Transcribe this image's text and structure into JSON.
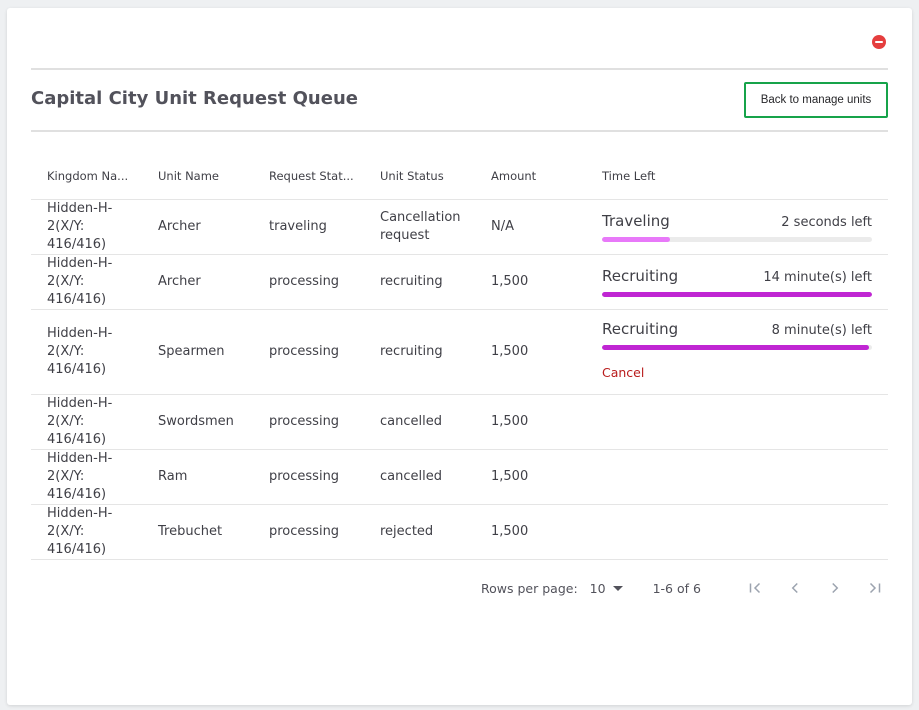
{
  "header": {
    "title": "Capital City Unit Request Queue",
    "back_button_label": "Back to manage units",
    "close_icon": "minus-circle-icon",
    "close_color": "#e53e3e",
    "back_button_border_color": "#16a34a"
  },
  "table": {
    "columns": [
      "Kingdom Na...",
      "Unit Name",
      "Request Stat...",
      "Unit Status",
      "Amount",
      "Time Left"
    ],
    "rows": [
      {
        "kingdom": "Hidden-H-2(X/Y: 416/416)",
        "unit_name": "Archer",
        "request_status": "traveling",
        "unit_status": "Cancellation request",
        "amount": "N/A",
        "time_status": "Traveling",
        "time_remaining": "2 seconds left",
        "progress": 0.25,
        "has_cancel": false
      },
      {
        "kingdom": "Hidden-H-2(X/Y: 416/416)",
        "unit_name": "Archer",
        "request_status": "processing",
        "unit_status": "recruiting",
        "amount": "1,500",
        "time_status": "Recruiting",
        "time_remaining": "14 minute(s) left",
        "progress": 1.0,
        "has_cancel": false
      },
      {
        "kingdom": "Hidden-H-2(X/Y: 416/416)",
        "unit_name": "Spearmen",
        "request_status": "processing",
        "unit_status": "recruiting",
        "amount": "1,500",
        "time_status": "Recruiting",
        "time_remaining": "8 minute(s) left",
        "progress": 0.99,
        "has_cancel": true,
        "cancel_label": "Cancel"
      },
      {
        "kingdom": "Hidden-H-2(X/Y: 416/416)",
        "unit_name": "Swordsmen",
        "request_status": "processing",
        "unit_status": "cancelled",
        "amount": "1,500",
        "time_status": "",
        "time_remaining": "",
        "progress": null,
        "has_cancel": false
      },
      {
        "kingdom": "Hidden-H-2(X/Y: 416/416)",
        "unit_name": "Ram",
        "request_status": "processing",
        "unit_status": "cancelled",
        "amount": "1,500",
        "time_status": "",
        "time_remaining": "",
        "progress": null,
        "has_cancel": false
      },
      {
        "kingdom": "Hidden-H-2(X/Y: 416/416)",
        "unit_name": "Trebuchet",
        "request_status": "processing",
        "unit_status": "rejected",
        "amount": "1,500",
        "time_status": "",
        "time_remaining": "",
        "progress": null,
        "has_cancel": false
      }
    ],
    "colors": {
      "traveling_bar": "#e879f9",
      "recruiting_bar": "#c026d3",
      "cancel_link": "#b91c1c"
    }
  },
  "pagination": {
    "rows_per_page_label": "Rows per page:",
    "rows_per_page_value": "10",
    "range_label": "1-6 of 6",
    "icons": [
      "first-page-icon",
      "previous-page-icon",
      "next-page-icon",
      "last-page-icon"
    ]
  }
}
